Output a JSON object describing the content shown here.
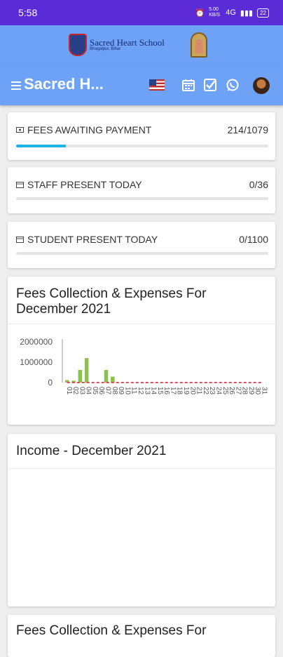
{
  "status_bar": {
    "time": "5:58",
    "network": "5.00 KB/S",
    "signal": "4G",
    "battery": "22"
  },
  "header": {
    "school_name": "Sacred Heart School",
    "school_sub": "Bhagalpur, Bihar"
  },
  "toolbar": {
    "title": "Sacred H...",
    "icons": [
      "menu-icon",
      "us-flag-icon",
      "calendar-icon",
      "checkbox-icon",
      "whatsapp-icon",
      "avatar"
    ],
    "accent": "#6ea2f7"
  },
  "stats": [
    {
      "label": "FEES AWAITING PAYMENT",
      "value": "214/1079",
      "progress_pct": 19.8,
      "icon": "money-icon"
    },
    {
      "label": "STAFF PRESENT TODAY",
      "value": "0/36",
      "progress_pct": 0,
      "icon": "calendar-icon"
    },
    {
      "label": "STUDENT PRESENT TODAY",
      "value": "0/1100",
      "progress_pct": 0,
      "icon": "calendar-icon"
    }
  ],
  "fees_chart_title": "Fees Collection & Expenses For December 2021",
  "income_title": "Income - December 2021",
  "next_card_title": "Fees Collection & Expenses For",
  "colors": {
    "income_bar": "#8bc34a",
    "expense_line": "#e05060",
    "progress": "#1fb4e6",
    "status_bar": "#5b2bd6"
  },
  "chart_data": {
    "type": "bar",
    "categories": [
      "01",
      "02",
      "03",
      "04",
      "05",
      "06",
      "07",
      "08",
      "09",
      "10",
      "11",
      "12",
      "13",
      "14",
      "15",
      "16",
      "17",
      "18",
      "19",
      "20",
      "21",
      "22",
      "23",
      "24",
      "25",
      "26",
      "27",
      "28",
      "29",
      "30",
      "31"
    ],
    "series": [
      {
        "values": [
          120000,
          90000,
          620000,
          1200000,
          0,
          0,
          620000,
          290000,
          0,
          0,
          0,
          0,
          0,
          0,
          0,
          0,
          0,
          0,
          0,
          0,
          0,
          0,
          0,
          0,
          0,
          0,
          0,
          0,
          0,
          0,
          0
        ]
      },
      {
        "values": [
          0,
          0,
          0,
          0,
          0,
          0,
          0,
          0,
          0,
          0,
          0,
          0,
          0,
          0,
          0,
          0,
          0,
          0,
          0,
          0,
          0,
          0,
          0,
          0,
          0,
          0,
          0,
          0,
          0,
          0,
          0
        ]
      }
    ],
    "y_ticks": [
      "2000000",
      "1000000",
      "0"
    ],
    "ylim": [
      0,
      2000000
    ],
    "grid": false
  }
}
